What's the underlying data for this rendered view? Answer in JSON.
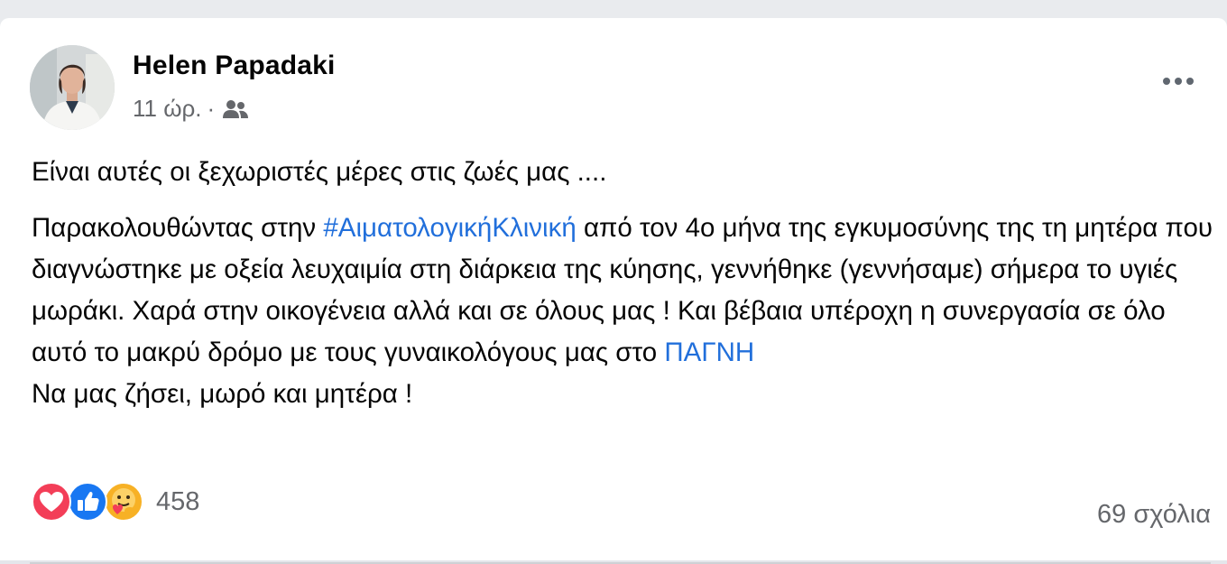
{
  "post": {
    "author": "Helen Papadaki",
    "time": "11 ώρ.",
    "separator": "·",
    "audience_icon": "friends-icon",
    "more_icon": "more-horizontal-icon",
    "text": {
      "line1": "Είναι αυτές οι ξεχωριστές μέρες στις ζωές μας ....",
      "p2_before_hashtag": "Παρακολουθώντας στην ",
      "hashtag": "#ΑιματολογικήΚλινική",
      "p2_after_hashtag": " από τον 4ο μήνα της εγκυμοσύνης της τη μητέρα που διαγνώστηκε με οξεία λευχαιμία στη διάρκεια της κύησης, γεννήθηκε (γεννήσαμε) σήμερα το υγιές μωράκι. Χαρά στην οικογένεια αλλά και σε όλους μας ! Και βέβαια υπέροχη η συνεργασία σε όλο αυτό το μακρύ δρόμο με τους γυναικολόγους μας στο ",
      "page_link": "ΠΑΓΝΗ",
      "closing": "Να μας ζήσει, μωρό και μητέρα !"
    },
    "reactions": {
      "icons": [
        "love-reaction-icon",
        "like-reaction-icon",
        "care-reaction-icon"
      ],
      "count": "458"
    },
    "comments": "69 σχόλια"
  },
  "colors": {
    "link": "#216fdb",
    "love": "#f33e58",
    "like": "#1877f2",
    "care": "#f7b125",
    "secondary_text": "#65676b"
  }
}
